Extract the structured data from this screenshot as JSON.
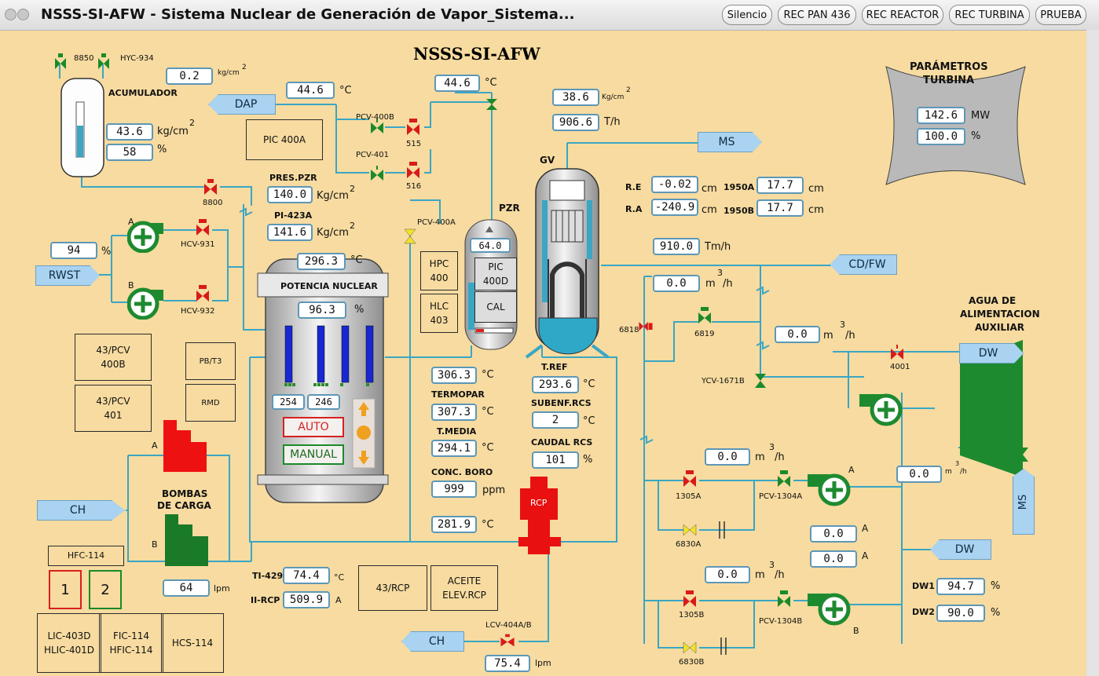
{
  "window": {
    "title": "NSSS-SI-AFW  - Sistema Nuclear de Generación de Vapor_Sistema...",
    "buttons": [
      "Silencio",
      "REC PAN 436",
      "REC REACTOR",
      "REC TURBINA",
      "PRUEBA"
    ]
  },
  "diagram": {
    "title": "NSSS-SI-AFW",
    "accumulator": {
      "label": "ACUMULADOR",
      "tag_valve": "8850",
      "tag_hyc": "HYC-934",
      "pressure": "43.6",
      "pressure_unit": "kg/cm",
      "level": "58",
      "level_unit": "%",
      "top_value": "0.2",
      "top_unit": "kg/cm"
    },
    "dap": {
      "label": "DAP",
      "temp": "44.6",
      "temp_unit": "°C"
    },
    "pic400a": "PIC 400A",
    "valves_top": {
      "pcv400b": "PCV-400B",
      "pcv401": "PCV-401",
      "v515": "515",
      "v516": "516"
    },
    "spray_temp": {
      "value": "44.6",
      "unit": "°C"
    },
    "gv_top": {
      "pressure": "38.6",
      "pressure_unit": "Kg/cm",
      "flow": "906.6",
      "flow_unit": "T/h"
    },
    "gv": {
      "label": "GV",
      "ms": "MS"
    },
    "levels": {
      "re_label": "R.E",
      "re": "-0.02",
      "ra_label": "R.A",
      "ra": "-240.9",
      "unit": "cm",
      "l1950a_label": "1950A",
      "l1950a": "17.7",
      "l1950b_label": "1950B",
      "l1950b": "17.7"
    },
    "turbine": {
      "title1": "PARÁMETROS",
      "title2": "TURBINA",
      "mw": "142.6",
      "mw_unit": "MW",
      "pct": "100.0",
      "pct_unit": "%"
    },
    "pzr": {
      "label": "PZR",
      "pres_label": "PRES.PZR",
      "pres": "140.0",
      "pres_unit": "Kg/cm",
      "pi_label": "PI-423A",
      "pi": "141.6",
      "pi_unit": "Kg/cm",
      "level": "64.0",
      "pcv400a": "PCV-400A",
      "hpc1": "HPC",
      "hpc2": "400",
      "hlc1": "HLC",
      "hlc2": "403",
      "pic1": "PIC",
      "pic2": "400D",
      "cal": "CAL"
    },
    "v8800": "8800",
    "rwst": {
      "label": "RWST",
      "level": "94",
      "unit": "%"
    },
    "pumps_si": {
      "a": "A",
      "b": "B",
      "hcv931": "HCV-931",
      "hcv932": "HCV-932"
    },
    "reactor": {
      "temp": "296.3",
      "temp_unit": "°C",
      "title": "POTENCIA NUCLEAR",
      "power": "96.3",
      "power_unit": "%",
      "rod1": "254",
      "rod2": "246",
      "auto": "AUTO",
      "manual": "MANUAL"
    },
    "feed": {
      "tm": "910.0",
      "tm_unit": "Tm/h",
      "cdfw": "CD/FW",
      "flow": "0.0",
      "flow_unit": "m",
      "flow_unit_tail": "/h",
      "v6818": "6818",
      "v6819": "6819",
      "flow2": "0.0",
      "ycv": "YCV-1671B"
    },
    "afw": {
      "title1": "AGUA DE",
      "title2": "ALIMENTACION",
      "title3": "AUXILIAR",
      "dw": "DW",
      "v4001": "4001",
      "ms": "MS",
      "flow_turb": "0.0"
    },
    "panels": {
      "p1a": "43/PCV",
      "p1b": "400B",
      "p2a": "43/PCV",
      "p2b": "401",
      "pbt3": "PB/T3",
      "rmd": "RMD"
    },
    "rcs": {
      "t1": "306.3",
      "termopar_label": "TERMOPAR",
      "termopar": "307.3",
      "tmedia_label": "T.MEDIA",
      "tmedia": "294.1",
      "boro_label": "CONC. BORO",
      "boro": "999",
      "boro_unit": "ppm",
      "t_cold": "281.9",
      "tref_label": "T.REF",
      "tref": "293.6",
      "subenf_label": "SUBENF.RCS",
      "subenf": "2",
      "caudal_label": "CAUDAL RCS",
      "caudal": "101",
      "caudal_unit": "%",
      "unit_c": "°C",
      "rcp": "RCP"
    },
    "charging": {
      "ch": "CH",
      "title1": "BOMBAS",
      "title2": "DE CARGA",
      "a": "A",
      "b": "B",
      "hfc": "HFC-114",
      "b1": "1",
      "b2": "2",
      "lpm": "64",
      "lpm_unit": "lpm",
      "lic1": "LIC-403D",
      "lic2": "HLIC-401D",
      "fic1": "FIC-114",
      "fic2": "HFIC-114",
      "hcs": "HCS-114"
    },
    "rcp_instr": {
      "ti_label": "TI-429",
      "ti": "74.4",
      "ti_unit": "°C",
      "ii_label": "II-RCP",
      "ii": "509.9",
      "ii_unit": "A",
      "p43rcp": "43/RCP",
      "aceite1": "ACEITE",
      "aceite2": "ELEV.RCP"
    },
    "letdown": {
      "ch": "CH",
      "lcv": "LCV-404A/B",
      "flow": "75.4",
      "unit": "lpm"
    },
    "mdafw": {
      "fa": "0.0",
      "v1305a": "1305A",
      "pcv1304a": "PCV-1304A",
      "v6830a": "6830A",
      "pa": "A",
      "fb": "0.0",
      "v1305b": "1305B",
      "pcv1304b": "PCV-1304B",
      "v6830b": "6830B",
      "pb": "B",
      "amp1": "0.0",
      "amp2": "0.0",
      "amp_unit": "A",
      "dw": "DW",
      "dw1_label": "DW1",
      "dw1": "94.7",
      "dw2_label": "DW2",
      "dw2": "90.0",
      "pct": "%"
    }
  }
}
